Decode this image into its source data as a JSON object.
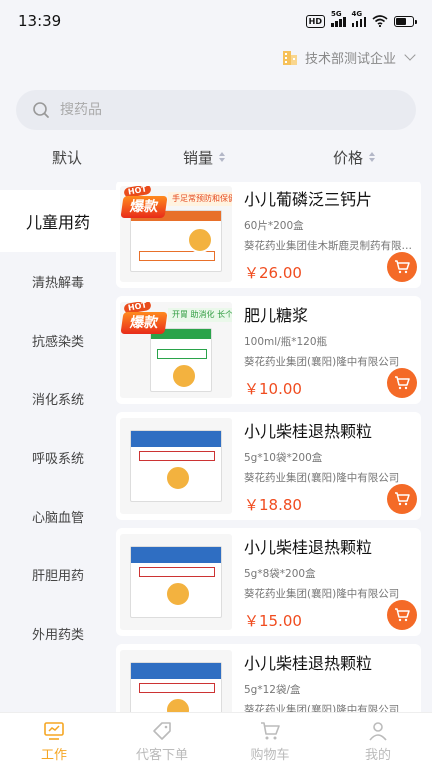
{
  "status_bar": {
    "time": "13:39",
    "hd": "HD",
    "net1": "5G",
    "net2": "4G"
  },
  "header": {
    "company_name": "技术部测试企业"
  },
  "search": {
    "placeholder": "搜药品"
  },
  "sort": [
    {
      "label": "默认",
      "has_arrows": false
    },
    {
      "label": "销量",
      "has_arrows": true
    },
    {
      "label": "价格",
      "has_arrows": true
    }
  ],
  "categories": [
    {
      "label": "儿童用药",
      "active": true
    },
    {
      "label": "清热解毒",
      "active": false
    },
    {
      "label": "抗感染类",
      "active": false
    },
    {
      "label": "消化系统",
      "active": false
    },
    {
      "label": "呼吸系统",
      "active": false
    },
    {
      "label": "心脑血管",
      "active": false
    },
    {
      "label": "肝胆用药",
      "active": false
    },
    {
      "label": "外用药类",
      "active": false
    }
  ],
  "products": [
    {
      "name": "小儿葡磷泛三钙片",
      "spec": "60片*200盒",
      "maker": "葵花药业集团佳木斯鹿灵制药有限公司",
      "price": "￥26.00",
      "hot": true,
      "promo": "手足常预防和保健",
      "promo_color": "orange"
    },
    {
      "name": "肥儿糖浆",
      "spec": "100ml/瓶*120瓶",
      "maker": "葵花药业集团(襄阳)隆中有限公司",
      "price": "￥10.00",
      "hot": true,
      "promo": "开胃 助消化 长个子",
      "promo_color": "green"
    },
    {
      "name": "小儿柴桂退热颗粒",
      "spec": "5g*10袋*200盒",
      "maker": "葵花药业集团(襄阳)隆中有限公司",
      "price": "￥18.80",
      "hot": false
    },
    {
      "name": "小儿柴桂退热颗粒",
      "spec": "5g*8袋*200盒",
      "maker": "葵花药业集团(襄阳)隆中有限公司",
      "price": "￥15.00",
      "hot": false
    },
    {
      "name": "小儿柴桂退热颗粒",
      "spec": "5g*12袋/盒",
      "maker": "葵花药业集团(襄阳)隆中有限公司",
      "price": "",
      "hot": false
    }
  ],
  "hot_badge": {
    "hot": "HOT",
    "text": "爆款"
  },
  "tabs": [
    {
      "label": "工作",
      "active": true,
      "icon": "work-icon"
    },
    {
      "label": "代客下单",
      "active": false,
      "icon": "order-tag-icon"
    },
    {
      "label": "购物车",
      "active": false,
      "icon": "cart-icon"
    },
    {
      "label": "我的",
      "active": false,
      "icon": "user-icon"
    }
  ],
  "colors": {
    "accent": "#f5a623",
    "price": "#f04c1f",
    "cart_button": "#f46a27"
  }
}
